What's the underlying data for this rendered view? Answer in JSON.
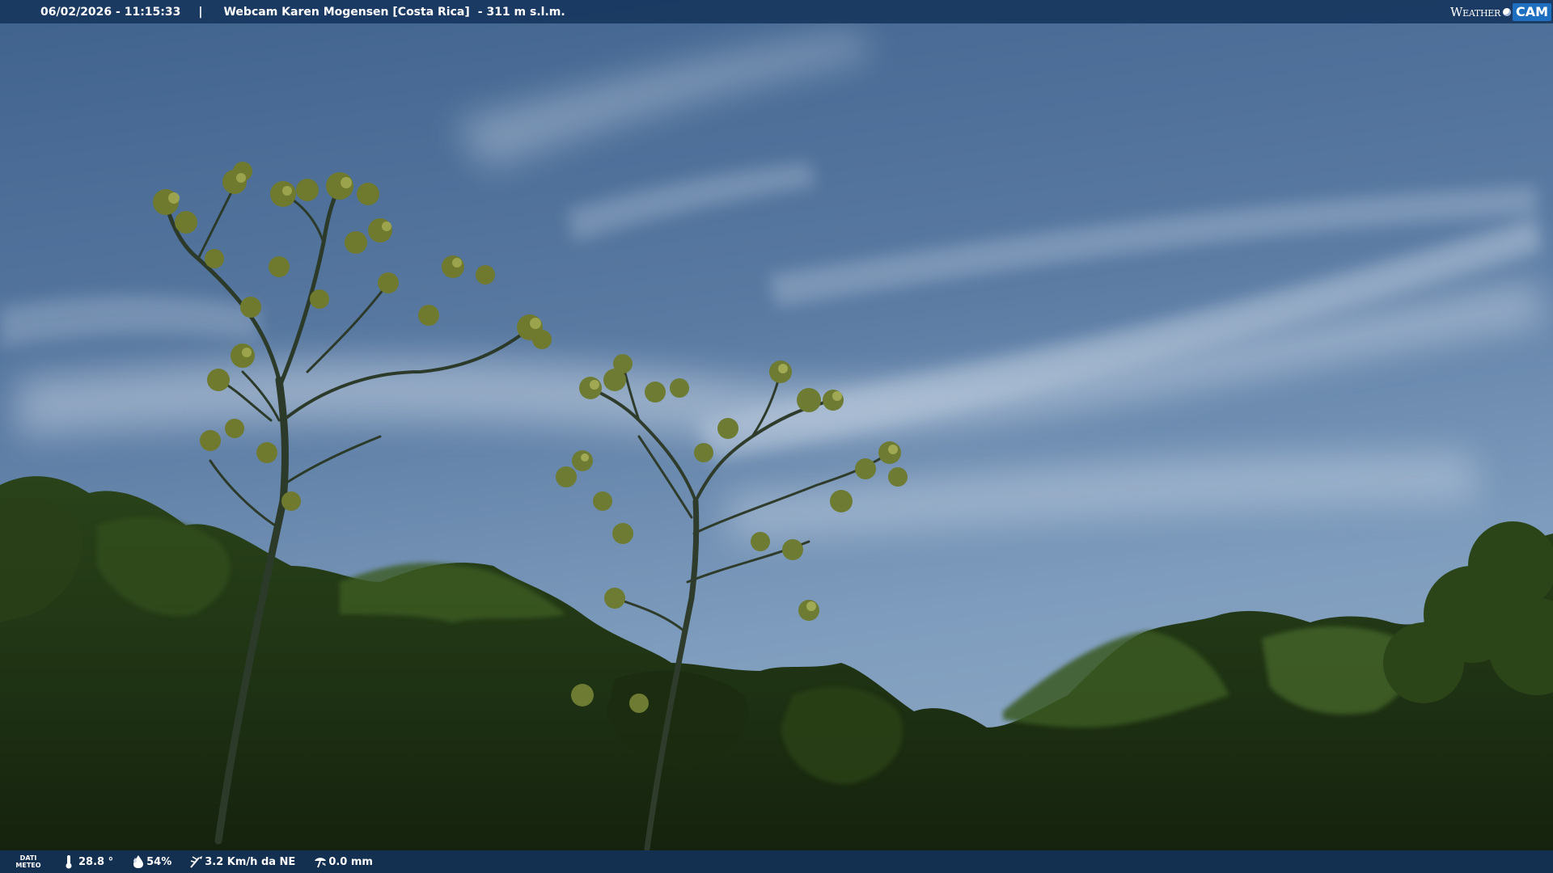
{
  "header": {
    "datetime": "06/02/2026 - 11:15:33",
    "separator": "|",
    "location": "Webcam Karen Mogensen [Costa Rica]",
    "altitude": "- 311 m s.l.m."
  },
  "brand": {
    "weather_text": "Weather",
    "cam_text": "CAM"
  },
  "footer": {
    "label_line1": "DATI",
    "label_line2": "METEO",
    "temperature": "28.8 °",
    "humidity": "54%",
    "wind": "3.2 Km/h da NE",
    "rain": "0.0 mm"
  },
  "icons": {
    "temperature": "thermometer-icon",
    "humidity": "humidity-drop-icon",
    "wind": "wind-icon",
    "rain": "rain-gauge-icon"
  },
  "colors": {
    "sky_top": "#3f628d",
    "sky_bottom": "#7e9cbd",
    "cloud": "#c9d6e4",
    "foliage_dark": "#1c2a14",
    "foliage_mid": "#34501f",
    "foliage_light": "#8f9a3a",
    "bar": "#16345c",
    "brand_cam": "#1f6fc1"
  }
}
